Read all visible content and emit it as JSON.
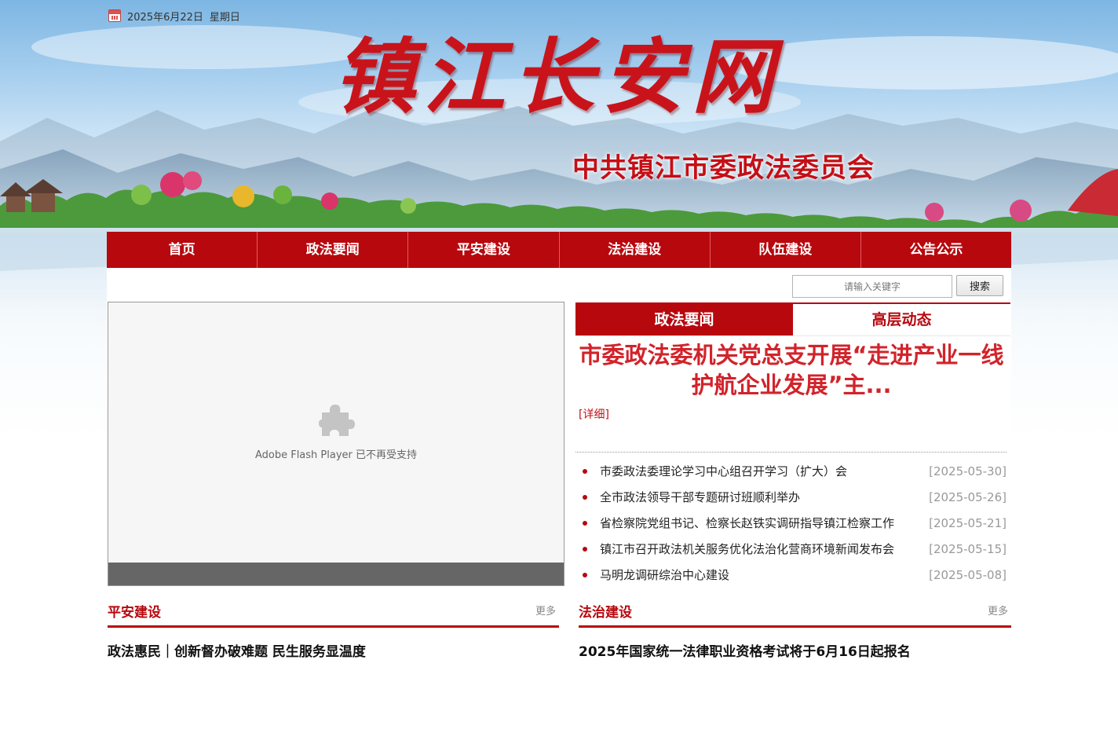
{
  "header": {
    "date": "2025年6月22日",
    "weekday": "星期日",
    "site_title": "镇江长安网",
    "site_subtitle": "中共镇江市委政法委员会"
  },
  "nav": {
    "items": [
      {
        "label": "首页"
      },
      {
        "label": "政法要闻"
      },
      {
        "label": "平安建设"
      },
      {
        "label": "法治建设"
      },
      {
        "label": "队伍建设"
      },
      {
        "label": "公告公示"
      }
    ]
  },
  "search": {
    "placeholder": "请输入关键字",
    "button_label": "搜索"
  },
  "flash": {
    "message": "Adobe Flash Player 已不再受支持"
  },
  "news": {
    "tabs": [
      {
        "label": "政法要闻",
        "active": true
      },
      {
        "label": "高层动态",
        "active": false
      }
    ],
    "headline": "市委政法委机关党总支开展“走进产业一线 护航企业发展”主...",
    "detail_label": "[详细]",
    "items": [
      {
        "title": "市委政法委理论学习中心组召开学习（扩大）会",
        "date": "[2025-05-30]"
      },
      {
        "title": "全市政法领导干部专题研讨班顺利举办",
        "date": "[2025-05-26]"
      },
      {
        "title": "省检察院党组书记、检察长赵铁实调研指导镇江检察工作",
        "date": "[2025-05-21]"
      },
      {
        "title": "镇江市召开政法机关服务优化法治化营商环境新闻发布会",
        "date": "[2025-05-15]"
      },
      {
        "title": "马明龙调研综治中心建设",
        "date": "[2025-05-08]"
      }
    ]
  },
  "sections": {
    "pingan": {
      "title": "平安建设",
      "more": "更多",
      "article": "政法惠民｜创新督办破难题 民生服务显温度"
    },
    "fazhi": {
      "title": "法治建设",
      "more": "更多",
      "article": "2025年国家统一法律职业资格考试将于6月16日起报名"
    }
  },
  "colors": {
    "brand_red": "#b7080e",
    "headline_red": "#d2232a",
    "date_gray": "#999999"
  }
}
